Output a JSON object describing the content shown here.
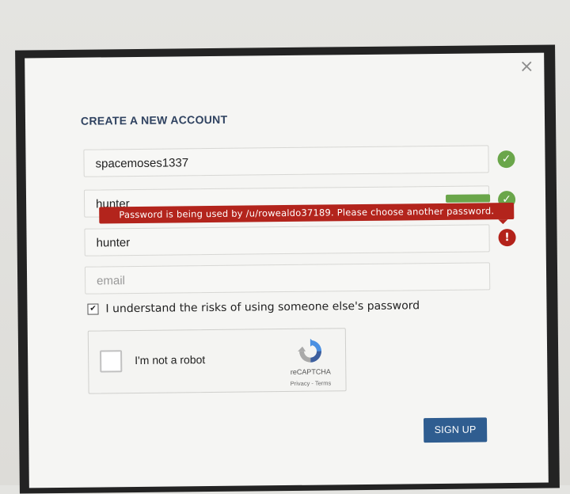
{
  "dialog": {
    "title": "CREATE A NEW ACCOUNT",
    "close_symbol": "×"
  },
  "form": {
    "username_value": "spacemoses1337",
    "password_value": "hunter",
    "confirm_password_value": "hunter",
    "email_placeholder": "email",
    "error_message": "Password is being used by /u/rowealdo37189. Please choose another password.",
    "agreement_label": "I understand the risks of using someone else's password",
    "agreement_checked": true
  },
  "captcha": {
    "label": "I'm not a robot",
    "brand": "reCAPTCHA",
    "links": "Privacy - Terms"
  },
  "buttons": {
    "signup_label": "SIGN UP"
  },
  "icons": {
    "check": "✓",
    "error": "!",
    "checkbox_mark": "✔"
  },
  "colors": {
    "success": "#6aa64a",
    "error": "#b3221a",
    "primary": "#2f5d90",
    "title": "#2f4260"
  }
}
